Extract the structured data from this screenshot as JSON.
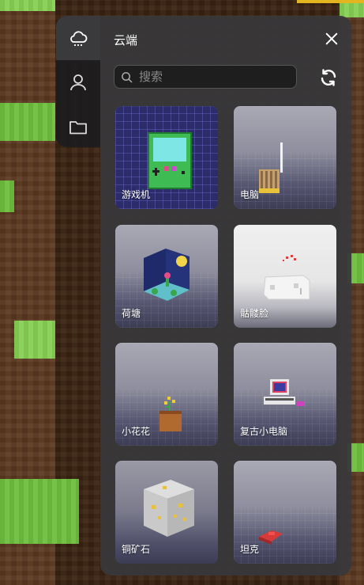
{
  "panel": {
    "title": "云端",
    "search_placeholder": "搜索"
  },
  "rail": {
    "items": [
      {
        "icon": "cloud-icon",
        "active": true
      },
      {
        "icon": "user-icon",
        "active": false
      },
      {
        "icon": "folder-icon",
        "active": false
      }
    ]
  },
  "cards": [
    {
      "label": "游戏机",
      "thumb": "handheld-console"
    },
    {
      "label": "电脑",
      "thumb": "computer"
    },
    {
      "label": "荷塘",
      "thumb": "lotus-pond"
    },
    {
      "label": "骷髅脸",
      "thumb": "skull-face"
    },
    {
      "label": "小花花",
      "thumb": "flower-pot"
    },
    {
      "label": "复古小电脑",
      "thumb": "retro-computer"
    },
    {
      "label": "铜矿石",
      "thumb": "copper-ore"
    },
    {
      "label": "坦克",
      "thumb": "tank"
    }
  ],
  "colors": {
    "accent_bar": "#e2b521",
    "panel_bg": "#38383a",
    "rail_bg": "#1c1c1e"
  }
}
